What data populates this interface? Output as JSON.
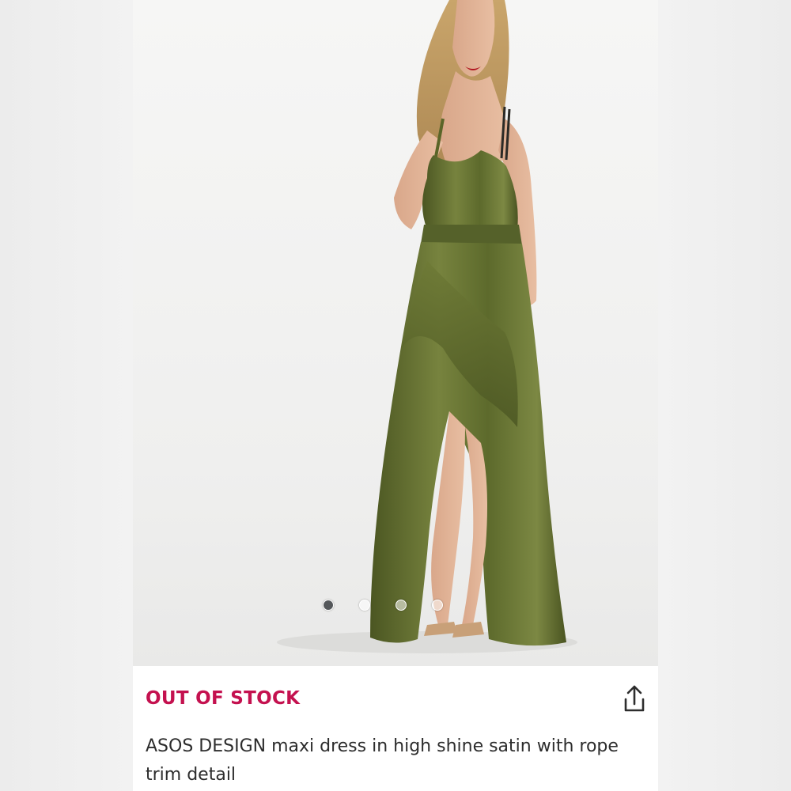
{
  "product": {
    "image_alt": "model wearing olive green high shine satin maxi dress",
    "carousel": {
      "count": 4,
      "active_index": 0
    },
    "status": "OUT OF STOCK",
    "share_icon": "share-icon",
    "title": "ASOS DESIGN maxi dress in high shine satin with rope trim detail"
  },
  "colors": {
    "status": "#c4114f",
    "title": "#2d2d2d",
    "dress": "#5d6a2c",
    "background": "#f3f3f3"
  }
}
